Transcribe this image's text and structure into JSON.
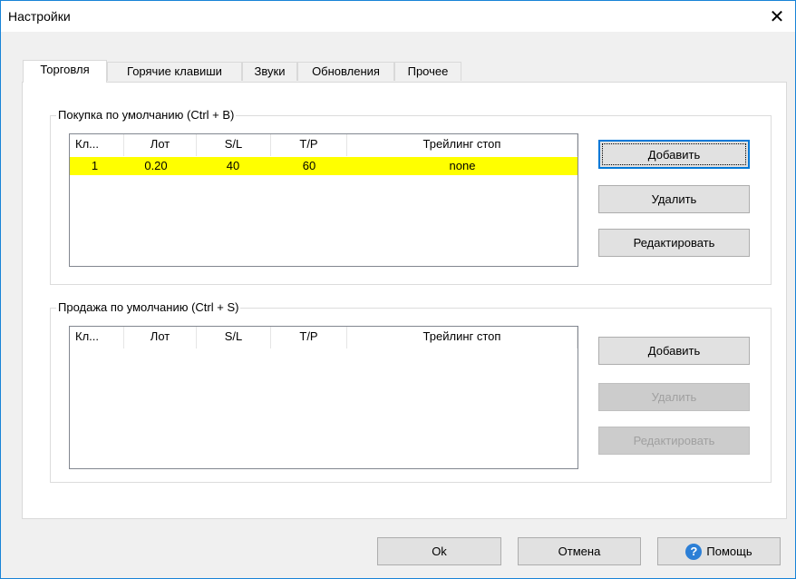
{
  "window": {
    "title": "Настройки",
    "close_icon": "close-icon"
  },
  "tabs": [
    {
      "label": "Торговля",
      "active": true
    },
    {
      "label": "Горячие клавиши",
      "active": false
    },
    {
      "label": "Звуки",
      "active": false
    },
    {
      "label": "Обновления",
      "active": false
    },
    {
      "label": "Прочее",
      "active": false
    }
  ],
  "buy": {
    "legend": "Покупка по умолчанию (Ctrl + B)",
    "columns": [
      "Кл...",
      "Лот",
      "S/L",
      "T/P",
      "Трейлинг стоп"
    ],
    "rows": [
      {
        "key": "1",
        "lot": "0.20",
        "sl": "40",
        "tp": "60",
        "trailing": "none",
        "highlight": "#ffff00"
      }
    ],
    "buttons": {
      "add": "Добавить",
      "delete": "Удалить",
      "edit": "Редактировать"
    }
  },
  "sell": {
    "legend": "Продажа по умолчанию (Ctrl + S)",
    "columns": [
      "Кл...",
      "Лот",
      "S/L",
      "T/P",
      "Трейлинг стоп"
    ],
    "rows": [],
    "buttons": {
      "add": "Добавить",
      "delete": "Удалить",
      "edit": "Редактировать"
    },
    "delete_disabled": true,
    "edit_disabled": true
  },
  "footer": {
    "ok": "Ok",
    "cancel": "Отмена",
    "help": "Помощь",
    "help_icon": "help-icon"
  },
  "colors": {
    "accent": "#0078d7",
    "row_highlight": "#ffff00",
    "window_border": "#1883d7"
  }
}
